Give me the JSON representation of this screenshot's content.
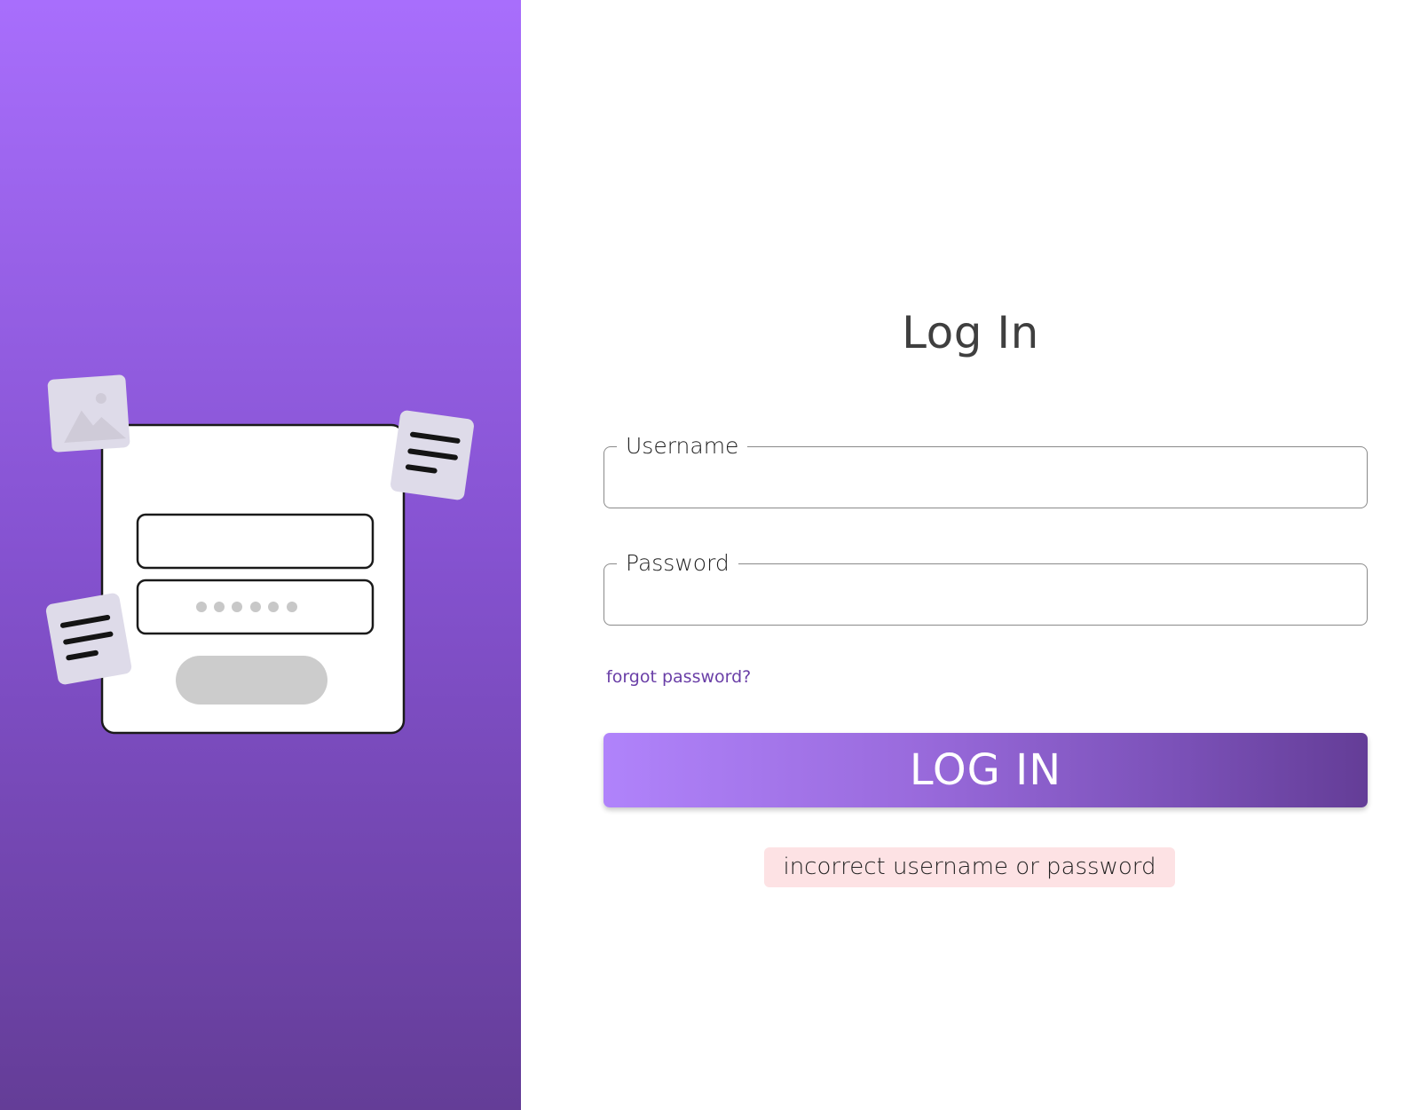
{
  "theme": {
    "accent": "#8552d0",
    "gradient_top": "#a86efc",
    "gradient_bottom": "#643d97",
    "link_color": "#6a3fa7",
    "error_background": "#fde2e4"
  },
  "illustration": {
    "icons": [
      "image-icon",
      "document-icon",
      "document-icon"
    ],
    "password_mask_dots": 6
  },
  "form": {
    "title": "Log In",
    "username": {
      "label": "Username",
      "value": "",
      "placeholder": ""
    },
    "password": {
      "label": "Password",
      "value": "",
      "placeholder": ""
    },
    "forgot_password_label": "forgot password?",
    "submit_label": "LOG IN",
    "error_message": "incorrect username or password"
  }
}
